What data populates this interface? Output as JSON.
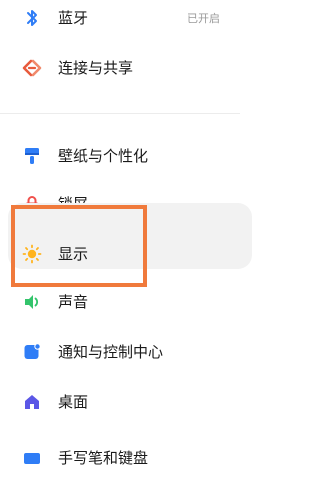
{
  "settings": {
    "items": [
      {
        "label": "蓝牙",
        "value": "已开启",
        "icon": "bluetooth-icon",
        "color": "#2f7df6"
      },
      {
        "label": "连接与共享",
        "icon": "connection-share-icon",
        "color": "#e85a3c"
      },
      {
        "label": "壁纸与个性化",
        "icon": "wallpaper-icon",
        "color": "#2f7df6"
      },
      {
        "label": "锁屏",
        "icon": "lock-icon",
        "color": "#f0504b"
      },
      {
        "label": "显示",
        "icon": "sun-icon",
        "color": "#ffb41e"
      },
      {
        "label": "声音",
        "icon": "speaker-icon",
        "color": "#33c46b"
      },
      {
        "label": "通知与控制中心",
        "icon": "notification-icon",
        "color": "#2f7df6"
      },
      {
        "label": "桌面",
        "icon": "home-icon",
        "color": "#5b57e6"
      },
      {
        "label": "手写笔和键盘",
        "icon": "keyboard-icon",
        "color": "#2f7df6"
      }
    ]
  },
  "highlight": {
    "target": "显示",
    "color": "#f07a3c"
  }
}
